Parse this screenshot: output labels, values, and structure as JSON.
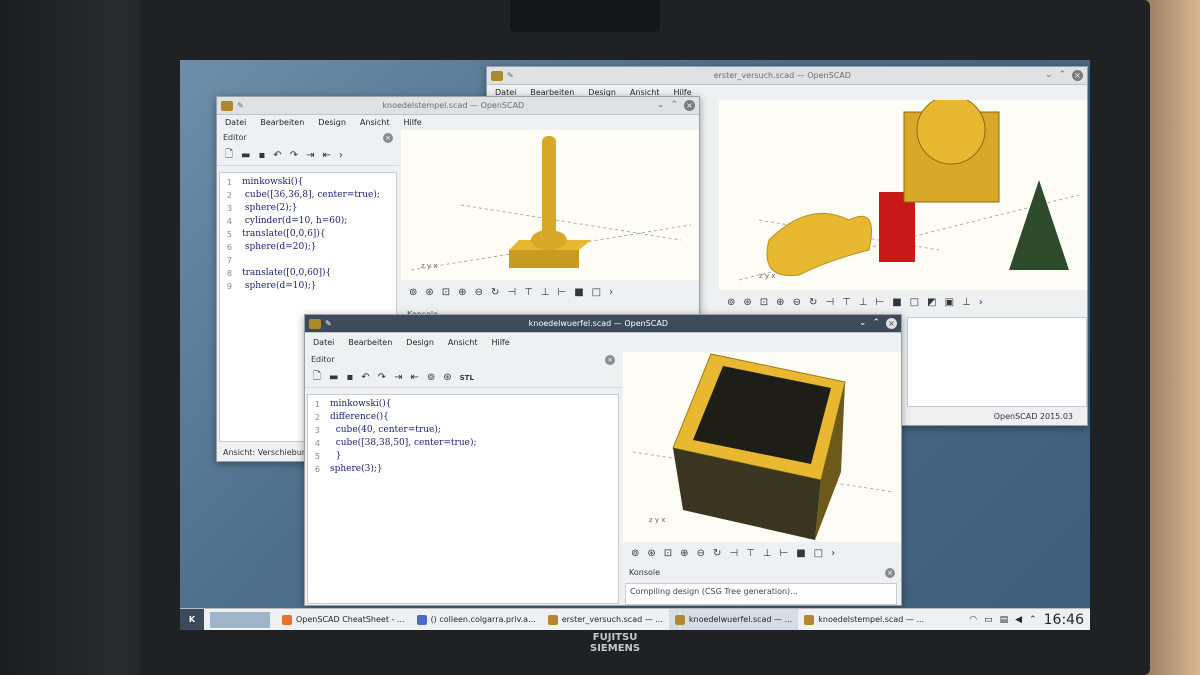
{
  "win_back": {
    "title": "erster_versuch.scad — OpenSCAD",
    "menu": [
      "Datei",
      "Bearbeiten",
      "Design",
      "Ansicht",
      "Hilfe"
    ],
    "status": "OpenSCAD 2015.03"
  },
  "win_mid": {
    "title": "knoedelstempel.scad — OpenSCAD",
    "menu": [
      "Datei",
      "Bearbeiten",
      "Design",
      "Ansicht",
      "Hilfe"
    ],
    "editor_title": "Editor",
    "code": [
      {
        "n": "1",
        "text": "minkowski(){"
      },
      {
        "n": "2",
        "text": " cube([36,36,8], center=true);"
      },
      {
        "n": "3",
        "text": " sphere(2);}"
      },
      {
        "n": "4",
        "text": " cylinder(d=10, h=60);"
      },
      {
        "n": "5",
        "text": "translate([0,0,6]){"
      },
      {
        "n": "6",
        "text": " sphere(d=20);}"
      },
      {
        "n": "7",
        "text": ""
      },
      {
        "n": "8",
        "text": "translate([0,0,60]){"
      },
      {
        "n": "9",
        "text": " sphere(d=10);}"
      }
    ],
    "status": "Ansicht: Verschiebung",
    "console_title": "Konsole"
  },
  "win_front": {
    "title": "knoedelwuerfel.scad — OpenSCAD",
    "menu": [
      "Datei",
      "Bearbeiten",
      "Design",
      "Ansicht",
      "Hilfe"
    ],
    "editor_title": "Editor",
    "code": [
      {
        "n": "1",
        "text": "minkowski(){"
      },
      {
        "n": "2",
        "text": "difference(){"
      },
      {
        "n": "3",
        "text": "  cube(40, center=true);"
      },
      {
        "n": "4",
        "text": "  cube([38,38,50], center=true);"
      },
      {
        "n": "5",
        "text": "  }"
      },
      {
        "n": "6",
        "text": "sphere(3);}"
      }
    ],
    "console_title": "Konsole",
    "console_text": "Compiling design (CSG Tree generation)...",
    "stl_label": "STL"
  },
  "taskbar": {
    "items": [
      {
        "label": "OpenSCAD CheatSheet - ...",
        "color": "#e8702a"
      },
      {
        "label": "() colleen.colgarra.priv.a...",
        "color": "#4a6cc4"
      },
      {
        "label": "erster_versuch.scad — ...",
        "color": "#b08a2a"
      },
      {
        "label": "knoedelwuerfel.scad — ...",
        "color": "#b08a2a"
      },
      {
        "label": "knoedelstempel.scad — ...",
        "color": "#b08a2a"
      }
    ],
    "clock": "16:46"
  },
  "brand": {
    "line1": "FUJITSU",
    "line2": "SIEMENS"
  },
  "colors": {
    "model_yellow": "#e8b830",
    "model_shade": "#6b5a1a",
    "red_cube": "#c81818",
    "green_cone": "#2d4a2a"
  }
}
